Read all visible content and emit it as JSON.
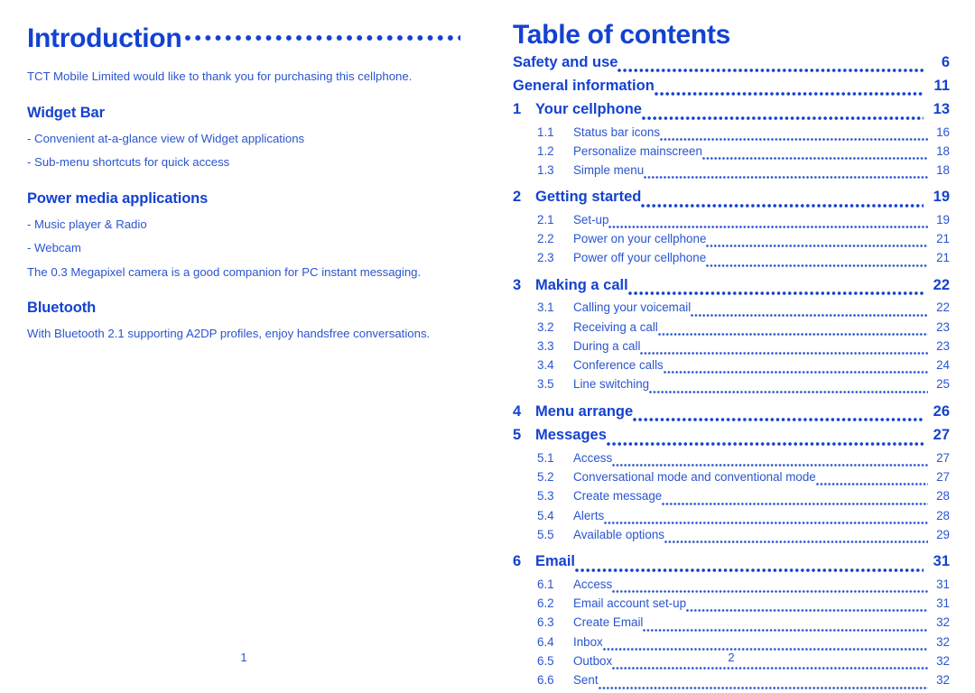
{
  "theme": {
    "heading_blue": "#1442d0",
    "body_blue": "#2a55cf",
    "page_background": "#ffffff"
  },
  "left_page": {
    "title": "Introduction",
    "title_leader": "................................",
    "intro_paragraph": "TCT Mobile Limited would like to thank you for purchasing this cellphone.",
    "sections": [
      {
        "heading": "Widget Bar",
        "bullets": [
          "- Convenient at-a-glance view of Widget applications",
          "- Sub-menu shortcuts for quick access"
        ],
        "paragraph": ""
      },
      {
        "heading": "Power media applications",
        "bullets": [
          "- Music player & Radio",
          "- Webcam"
        ],
        "paragraph": "The 0.3 Megapixel camera is a good companion for PC instant messaging."
      },
      {
        "heading": "Bluetooth",
        "bullets": [],
        "paragraph": "With Bluetooth 2.1 supporting A2DP profiles, enjoy handsfree conversations."
      }
    ],
    "folio": "1"
  },
  "right_page": {
    "title": "Table of contents",
    "entries": [
      {
        "level": "front",
        "number": "",
        "label": "Safety and use",
        "page": "6"
      },
      {
        "level": "front",
        "number": "",
        "label": "General information ",
        "page": "11"
      },
      {
        "level": "chap",
        "number": "1",
        "label": "Your cellphone",
        "page": "13"
      },
      {
        "level": "sub",
        "number": "1.1",
        "label": "Status bar icons",
        "page": "16"
      },
      {
        "level": "sub",
        "number": "1.2",
        "label": "Personalize mainscreen",
        "page": "18"
      },
      {
        "level": "sub",
        "number": "1.3",
        "label": "Simple menu ",
        "page": "18"
      },
      {
        "level": "chap",
        "number": "2",
        "label": "Getting started",
        "page": "19"
      },
      {
        "level": "sub",
        "number": "2.1",
        "label": "Set-up ",
        "page": "19"
      },
      {
        "level": "sub",
        "number": "2.2",
        "label": "Power on your cellphone",
        "page": "21"
      },
      {
        "level": "sub",
        "number": "2.3",
        "label": "Power off your cellphone",
        "page": "21"
      },
      {
        "level": "chap",
        "number": "3",
        "label": "Making a call ",
        "page": "22"
      },
      {
        "level": "sub",
        "number": "3.1",
        "label": "Calling your voicemail ",
        "page": "22"
      },
      {
        "level": "sub",
        "number": "3.2",
        "label": "Receiving a call ",
        "page": "23"
      },
      {
        "level": "sub",
        "number": "3.3",
        "label": "During a call",
        "page": "23"
      },
      {
        "level": "sub",
        "number": "3.4",
        "label": "Conference calls ",
        "page": "24"
      },
      {
        "level": "sub",
        "number": "3.5",
        "label": "Line switching",
        "page": "25"
      },
      {
        "level": "chap",
        "number": "4",
        "label": "Menu arrange",
        "page": "26"
      },
      {
        "level": "chap",
        "number": "5",
        "label": "Messages",
        "page": "27"
      },
      {
        "level": "sub",
        "number": "5.1",
        "label": "Access ",
        "page": "27"
      },
      {
        "level": "sub",
        "number": "5.2",
        "label": "Conversational mode and conventional mode",
        "page": "27"
      },
      {
        "level": "sub",
        "number": "5.3",
        "label": "Create message",
        "page": "28"
      },
      {
        "level": "sub",
        "number": "5.4",
        "label": "Alerts",
        "page": "28"
      },
      {
        "level": "sub",
        "number": "5.5",
        "label": "Available options",
        "page": "29"
      },
      {
        "level": "chap",
        "number": "6",
        "label": "Email",
        "page": "31"
      },
      {
        "level": "sub",
        "number": "6.1",
        "label": "Access ",
        "page": "31"
      },
      {
        "level": "sub",
        "number": "6.2",
        "label": "Email account set-up",
        "page": "31"
      },
      {
        "level": "sub",
        "number": "6.3",
        "label": "Create Email ",
        "page": "32"
      },
      {
        "level": "sub",
        "number": "6.4",
        "label": "Inbox",
        "page": "32"
      },
      {
        "level": "sub",
        "number": "6.5",
        "label": "Outbox",
        "page": "32"
      },
      {
        "level": "sub",
        "number": "6.6",
        "label": "Sent",
        "page": "32"
      }
    ],
    "folio": "2"
  }
}
